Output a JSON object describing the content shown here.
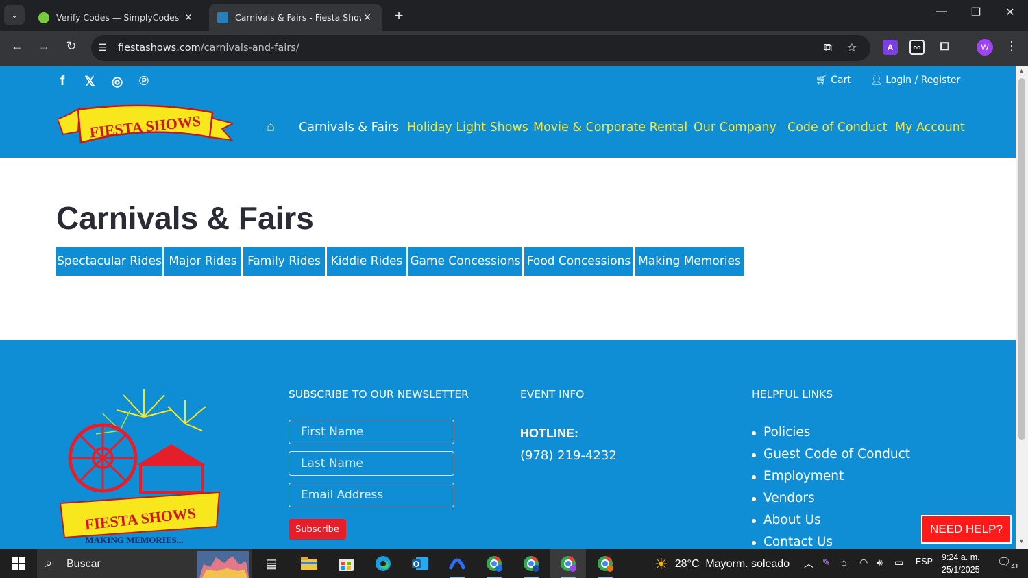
{
  "browser": {
    "tabs": [
      {
        "title": "Verify Codes — SimplyCodes",
        "active": false
      },
      {
        "title": "Carnivals & Fairs - Fiesta Shows",
        "active": true
      }
    ],
    "url_host": "fiestashows.com",
    "url_path": "/carnivals-and-fairs/",
    "profile_initial": "W"
  },
  "site": {
    "top_links": {
      "cart": "Cart",
      "login": "Login / Register"
    },
    "logo_text": "FIESTA SHOWS",
    "nav": [
      {
        "label": "Carnivals & Fairs",
        "current": true
      },
      {
        "label": "Holiday Light Shows",
        "current": false
      },
      {
        "label": "Movie & Corporate Rental",
        "current": false
      },
      {
        "label": "Our Company",
        "current": false
      },
      {
        "label": "Code of Conduct",
        "current": false
      },
      {
        "label": "My Account",
        "current": false
      }
    ],
    "colors": {
      "header_bg": "#0f8ed6",
      "nav_text": "#f5e63a",
      "accent_red": "#e41f2a"
    }
  },
  "main": {
    "title": "Carnivals & Fairs",
    "categories": [
      "Spectacular Rides",
      "Major Rides",
      "Family Rides",
      "Kiddie Rides",
      "Game Concessions",
      "Food Concessions",
      "Making Memories"
    ]
  },
  "footer": {
    "logo_text": "FIESTA SHOWS",
    "logo_tagline": "MAKING MEMORIES...",
    "newsletter": {
      "heading": "SUBSCRIBE TO OUR NEWSLETTER",
      "first_name_placeholder": "First Name",
      "last_name_placeholder": "Last Name",
      "email_placeholder": "Email Address",
      "button": "Subscribe"
    },
    "event_info": {
      "heading": "EVENT INFO",
      "hotline_label": "HOTLINE:",
      "hotline_number": "(978) 219-4232"
    },
    "helpful_links": {
      "heading": "HELPFUL LINKS",
      "items": [
        "Policies",
        "Guest Code of Conduct",
        "Employment",
        "Vendors",
        "About Us",
        "Contact Us"
      ]
    },
    "need_help": "NEED HELP?"
  },
  "taskbar": {
    "search_label": "Buscar",
    "weather": "28°C  Mayorm. soleado",
    "language": "ESP",
    "time": "9:24 a. m.",
    "date": "25/1/2025",
    "notifications": "41"
  }
}
